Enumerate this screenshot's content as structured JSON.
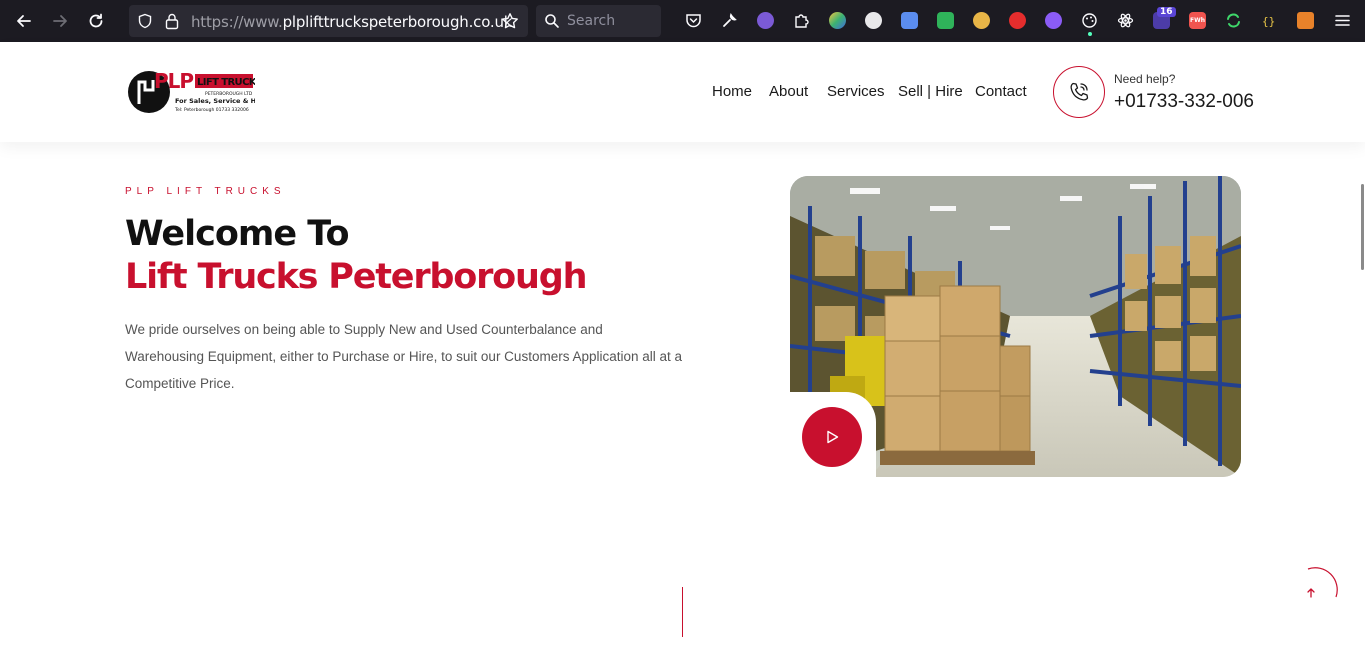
{
  "browser": {
    "url_prefix": "https://www.",
    "url_domain": "plplifttruckspeterborough.co.uk",
    "search_placeholder": "Search",
    "badge_count": "16",
    "fwh_label": "FWh"
  },
  "header": {
    "logo": {
      "brand": "PLP",
      "sub": "LIFT TRUCKS",
      "company": "PETERBOROUGH LTD",
      "tagline": "For Sales, Service & Hire",
      "tel": "Tel: Peterborough 01733 332006"
    },
    "nav": [
      "Home",
      "About",
      "Services",
      "Sell | Hire",
      "Contact"
    ],
    "need_help": "Need help?",
    "phone": "+01733-332-006"
  },
  "hero": {
    "eyebrow": "PLP LIFT TRUCKS",
    "title_line1": "Welcome To",
    "title_line2": "Lift Trucks Peterborough",
    "intro": "We pride ourselves on being able to Supply New and Used Counterbalance and Warehousing Equipment, either to Purchase or Hire, to suit our Customers Application all at a Competitive Price."
  },
  "colors": {
    "accent": "#c8102e",
    "browser_bg": "#1c1b22",
    "text": "#111111"
  }
}
